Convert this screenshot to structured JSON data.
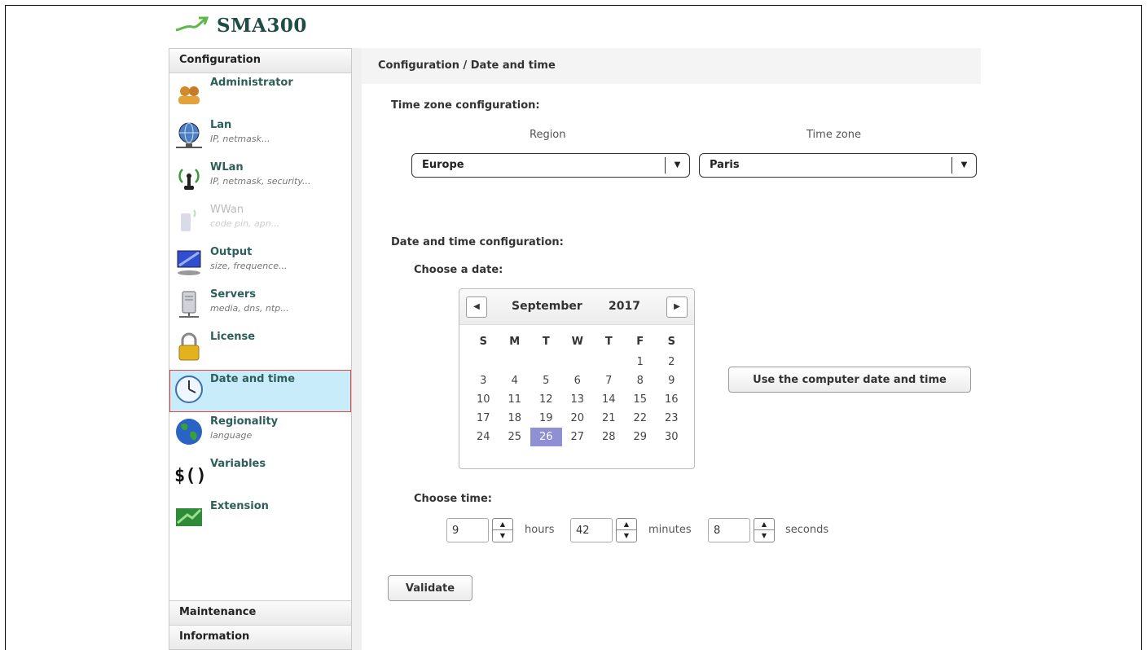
{
  "app": {
    "title": "SMA300"
  },
  "sidebar": {
    "header": "Configuration",
    "items": [
      {
        "label": "Administrator",
        "sub": ""
      },
      {
        "label": "Lan",
        "sub": "IP, netmask..."
      },
      {
        "label": "WLan",
        "sub": "IP, netmask, security..."
      },
      {
        "label": "WWan",
        "sub": "code pin, apn..."
      },
      {
        "label": "Output",
        "sub": "size, frequence..."
      },
      {
        "label": "Servers",
        "sub": "media, dns, ntp..."
      },
      {
        "label": "License",
        "sub": ""
      },
      {
        "label": "Date and time",
        "sub": ""
      },
      {
        "label": "Regionality",
        "sub": "language"
      },
      {
        "label": "Variables",
        "sub": ""
      },
      {
        "label": "Extension",
        "sub": ""
      }
    ],
    "bottom": {
      "maintenance": "Maintenance",
      "information": "Information"
    }
  },
  "main": {
    "breadcrumb": "Configuration / Date and time",
    "timezone": {
      "title": "Time zone configuration:",
      "region_label": "Region",
      "zone_label": "Time zone",
      "region_value": "Europe",
      "zone_value": "Paris"
    },
    "datetime": {
      "title": "Date and time configuration:",
      "choose_date": "Choose a date:",
      "calendar": {
        "month": "September",
        "year": "2017",
        "weekdays": [
          "S",
          "M",
          "T",
          "W",
          "T",
          "F",
          "S"
        ],
        "weeks": [
          [
            "",
            "",
            "",
            "",
            "",
            "1",
            "2"
          ],
          [
            "3",
            "4",
            "5",
            "6",
            "7",
            "8",
            "9"
          ],
          [
            "10",
            "11",
            "12",
            "13",
            "14",
            "15",
            "16"
          ],
          [
            "17",
            "18",
            "19",
            "20",
            "21",
            "22",
            "23"
          ],
          [
            "24",
            "25",
            "26",
            "27",
            "28",
            "29",
            "30"
          ]
        ],
        "selected": "26"
      },
      "use_computer_button": "Use the computer date and time",
      "choose_time": "Choose time:",
      "time": {
        "hours": "9",
        "minutes": "42",
        "seconds": "8"
      },
      "units": {
        "hours": "hours",
        "minutes": "minutes",
        "seconds": "seconds"
      }
    },
    "validate_button": "Validate"
  },
  "colors": {
    "accent": "#2d5f5a",
    "selected_item_bg": "#c8ecf9",
    "selected_day": "#8f8fd4",
    "active_border": "#dd4444"
  }
}
